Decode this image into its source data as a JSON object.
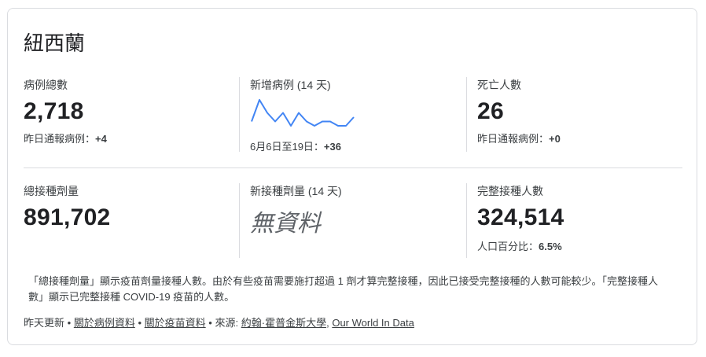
{
  "country": "紐西蘭",
  "cases": {
    "total_label": "病例總數",
    "total_value": "2,718",
    "total_sub_label": "昨日通報病例：",
    "total_sub_value": "+4",
    "new_label": "新增病例 (14 天)",
    "new_sub_label": "6月6日至19日：",
    "new_sub_value": "+36",
    "deaths_label": "死亡人數",
    "deaths_value": "26",
    "deaths_sub_label": "昨日通報病例：",
    "deaths_sub_value": "+0"
  },
  "sparkline": {
    "values": [
      1,
      6,
      3,
      1,
      3,
      0,
      3,
      1,
      0,
      1,
      1,
      0,
      0,
      2
    ],
    "color": "#4285f4"
  },
  "vaccines": {
    "doses_label": "總接種劑量",
    "doses_value": "891,702",
    "new_doses_label": "新接種劑量 (14 天)",
    "new_doses_value": "無資料",
    "full_label": "完整接種人數",
    "full_value": "324,514",
    "full_sub_label": "人口百分比：",
    "full_sub_value": "6.5%"
  },
  "note": "「總接種劑量」顯示疫苗劑量接種人數。由於有些疫苗需要施打超過 1 劑才算完整接種，因此已接受完整接種的人數可能較少。「完整接種人數」顯示已完整接種 COVID-19 疫苗的人數。",
  "footer": {
    "updated": "昨天更新",
    "sep1": "•",
    "link_cases": "關於病例資料",
    "sep2": "•",
    "link_vaccines": "關於疫苗資料",
    "sep3": "•",
    "source_label": "來源:",
    "link_jhu": "約翰·霍普金斯大學",
    "comma": ",",
    "link_owid": "Our World In Data"
  }
}
